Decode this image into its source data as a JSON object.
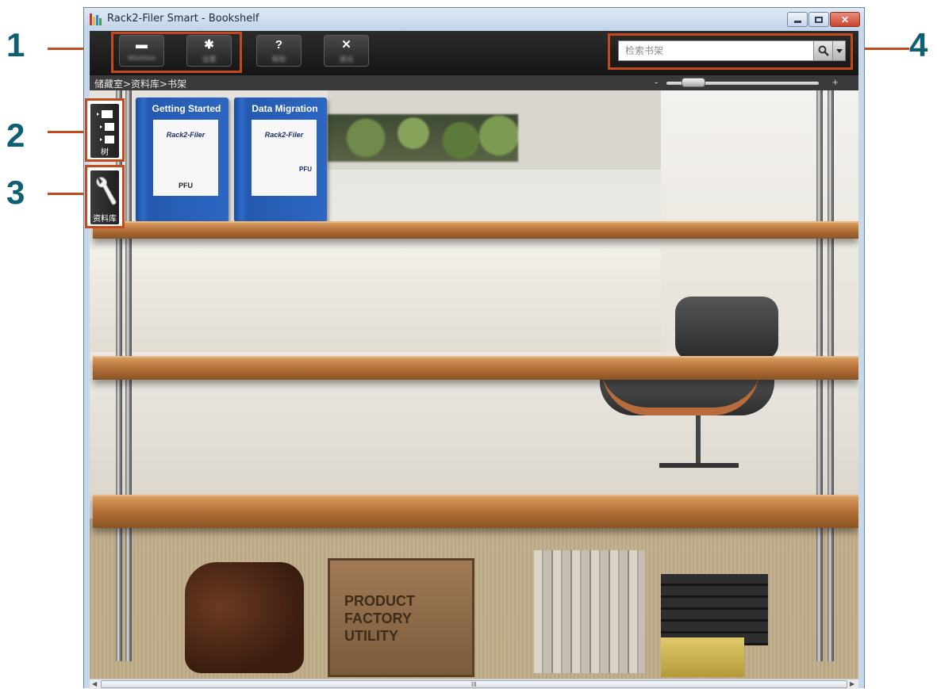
{
  "window": {
    "title": "Rack2-Filer Smart - Bookshelf"
  },
  "callouts": [
    "1",
    "2",
    "3",
    "4"
  ],
  "toolbar": {
    "buttons": [
      {
        "icon": "drive-icon",
        "glyph": "▬",
        "label": "Workbox"
      },
      {
        "icon": "gear-icon",
        "glyph": "✱",
        "label": "设置"
      },
      {
        "icon": "help-icon",
        "glyph": "?",
        "label": "帮助"
      },
      {
        "icon": "close-icon",
        "glyph": "✕",
        "label": "退出"
      }
    ]
  },
  "search": {
    "placeholder": "检索书架"
  },
  "breadcrumb": {
    "text": "储藏室>资料库>书架"
  },
  "zoom": {
    "minus": "-",
    "plus": "+",
    "level": 0.1
  },
  "side_buttons": [
    {
      "icon": "tree-icon",
      "caption": "树"
    },
    {
      "icon": "wrench-icon",
      "caption": "资料库"
    }
  ],
  "binders": [
    {
      "title": "Getting Started",
      "logo": "Rack2-Filer",
      "brand": "PFU"
    },
    {
      "title": "Data Migration",
      "logo": "Rack2-Filer",
      "brand": "PFU"
    }
  ],
  "scene": {
    "crate_text": [
      "PRODUCT",
      "FACTORY",
      "UTILITY"
    ]
  },
  "scrollbar": {
    "grip": "III"
  }
}
